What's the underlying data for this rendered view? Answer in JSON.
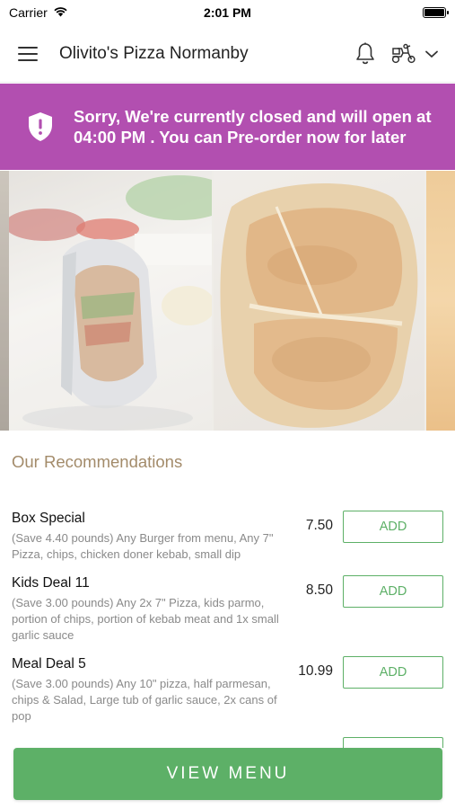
{
  "status_bar": {
    "carrier": "Carrier",
    "time": "2:01 PM"
  },
  "header": {
    "title": "Olivito's Pizza Normanby"
  },
  "icons": {
    "menu": "hamburger-menu-icon",
    "bell": "bell-icon",
    "scooter": "delivery-scooter-icon",
    "chevron": "chevron-down-icon",
    "shield": "shield-alert-icon"
  },
  "banner": {
    "message": "Sorry, We're currently closed and will open at 04:00 PM . You can Pre-order now for later",
    "background": "#b24fb0"
  },
  "carousel": {
    "slides": [
      "wrap-sandwich",
      "calzone-pizza",
      "chips"
    ]
  },
  "recommendations": {
    "heading": "Our Recommendations",
    "items": [
      {
        "name": "Box Special",
        "description": "(Save 4.40 pounds) Any Burger from menu, Any 7\" Pizza, chips, chicken doner kebab, small dip",
        "price": "7.50",
        "add_label": "ADD"
      },
      {
        "name": "Kids Deal 11",
        "description": "(Save 3.00 pounds) Any 2x 7\" Pizza, kids parmo, portion of chips, portion of kebab meat and 1x small garlic sauce",
        "price": "8.50",
        "add_label": "ADD"
      },
      {
        "name": "Meal Deal 5",
        "description": "(Save 3.00 pounds) Any 10\" pizza, half parmesan, chips & Salad, Large tub of garlic sauce, 2x cans of pop",
        "price": "10.99",
        "add_label": "ADD"
      }
    ]
  },
  "footer": {
    "view_menu_label": "VIEW MENU"
  },
  "colors": {
    "accent_green": "#5db067",
    "heading_tan": "#a38b6a",
    "banner_purple": "#b24fb0"
  }
}
